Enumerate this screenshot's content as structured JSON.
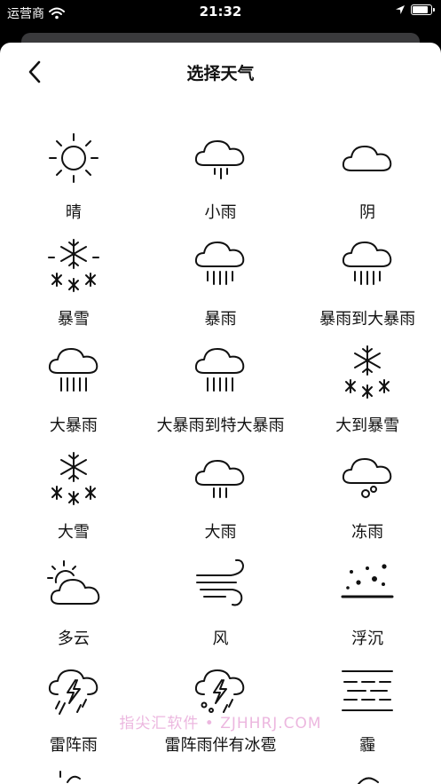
{
  "status_bar": {
    "carrier": "运营商",
    "time": "21:32"
  },
  "nav": {
    "title": "选择天气"
  },
  "weather": [
    {
      "label": "晴",
      "icon": "sun-icon"
    },
    {
      "label": "小雨",
      "icon": "light-rain-icon"
    },
    {
      "label": "阴",
      "icon": "cloud-icon"
    },
    {
      "label": "暴雪",
      "icon": "heavy-snow-icon"
    },
    {
      "label": "暴雨",
      "icon": "rainstorm-icon"
    },
    {
      "label": "暴雨到大暴雨",
      "icon": "rainstorm-to-heavy-rainstorm-icon"
    },
    {
      "label": "大暴雨",
      "icon": "heavy-rainstorm-icon"
    },
    {
      "label": "大暴雨到特大暴雨",
      "icon": "heavy-to-severe-rainstorm-icon"
    },
    {
      "label": "大到暴雪",
      "icon": "heavy-to-snowstorm-icon"
    },
    {
      "label": "大雪",
      "icon": "snow-icon"
    },
    {
      "label": "大雨",
      "icon": "heavy-rain-icon"
    },
    {
      "label": "冻雨",
      "icon": "freezing-rain-icon"
    },
    {
      "label": "多云",
      "icon": "partly-cloudy-icon"
    },
    {
      "label": "风",
      "icon": "wind-icon"
    },
    {
      "label": "浮沉",
      "icon": "floating-dust-icon"
    },
    {
      "label": "雷阵雨",
      "icon": "thunderstorm-icon"
    },
    {
      "label": "雷阵雨伴有冰雹",
      "icon": "thunderstorm-hail-icon"
    },
    {
      "label": "霾",
      "icon": "haze-icon"
    }
  ],
  "watermark": "指尖汇软件 • ZJHHRJ.COM"
}
